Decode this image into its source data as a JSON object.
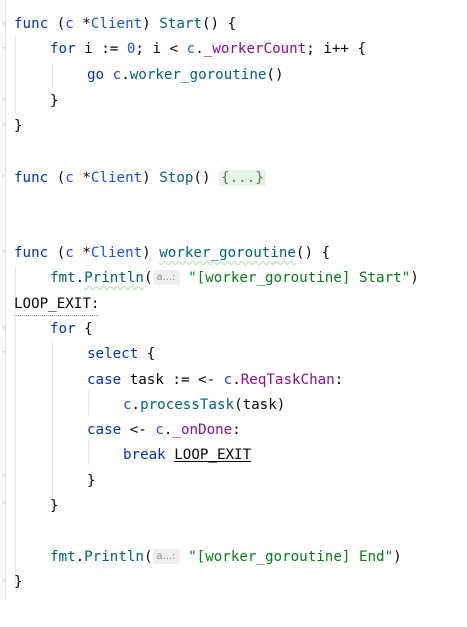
{
  "code": {
    "l1": [
      "func",
      " (",
      "c",
      " *",
      "Client",
      ") ",
      "Start",
      "() {"
    ],
    "l2": [
      "for",
      " i := ",
      "0",
      "; i < ",
      "c",
      ".",
      "_workerCount",
      "; i++ {"
    ],
    "l3": [
      "go",
      " ",
      "c",
      ".",
      "worker_goroutine",
      "()"
    ],
    "l4": "}",
    "l5": "}",
    "l7": [
      "func",
      " (",
      "c",
      " *",
      "Client",
      ") ",
      "Stop",
      "() ",
      "{...}"
    ],
    "l9": [
      "func",
      " (",
      "c",
      " *",
      "Client",
      ") ",
      "worker_goroutine",
      "() {"
    ],
    "l10": [
      "fmt",
      ".",
      "Println",
      "(",
      "a...:",
      " ",
      "\"[worker_goroutine] Start\"",
      ")"
    ],
    "l11": "LOOP_EXIT:",
    "l12": [
      "for",
      " {"
    ],
    "l13": [
      "select",
      " {"
    ],
    "l14": [
      "case",
      " task := <- ",
      "c",
      ".",
      "ReqTaskChan",
      ":"
    ],
    "l15": [
      "c",
      ".",
      "processTask",
      "(task)"
    ],
    "l16": [
      "case",
      " <- ",
      "c",
      ".",
      "_onDone",
      ":"
    ],
    "l17": [
      "break",
      " ",
      "LOOP_EXIT"
    ],
    "l18": "}",
    "l19": "}",
    "l21": [
      "fmt",
      ".",
      "Println",
      "(",
      "a...:",
      " ",
      "\"[worker_goroutine] End\"",
      ")"
    ],
    "l22": "}"
  },
  "colors": {
    "keyword": "#0033b3",
    "function": "#00627a",
    "field": "#871094",
    "string": "#067d17",
    "number": "#1750eb"
  }
}
